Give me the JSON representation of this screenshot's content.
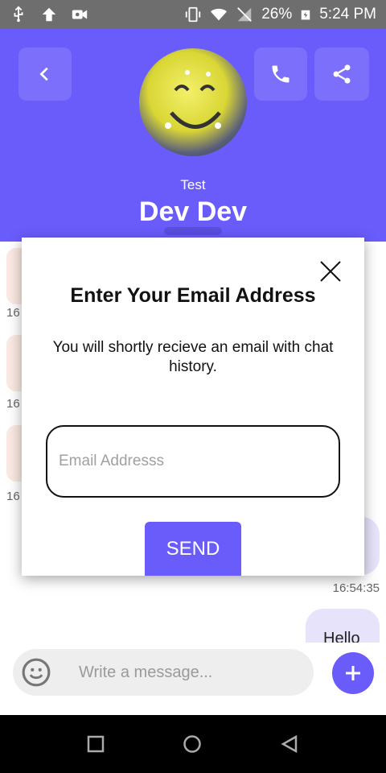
{
  "status_bar": {
    "battery": "26%",
    "time": "5:24 PM"
  },
  "header": {
    "subtitle": "Test",
    "title": "Dev Dev"
  },
  "chat": {
    "incoming_times": [
      "16",
      "16",
      "16"
    ],
    "outgoing_time": "16:54:35",
    "outgoing_message": "Hello"
  },
  "dialog": {
    "title": "Enter Your Email Address",
    "message": "You will shortly recieve an email with chat history.",
    "email_placeholder": "Email Addresss",
    "send_label": "SEND"
  },
  "composer": {
    "placeholder": "Write a message..."
  },
  "colors": {
    "accent": "#6a5cfb",
    "incoming_bubble": "#fbe9e3",
    "outgoing_bubble": "#e7e3fb"
  }
}
